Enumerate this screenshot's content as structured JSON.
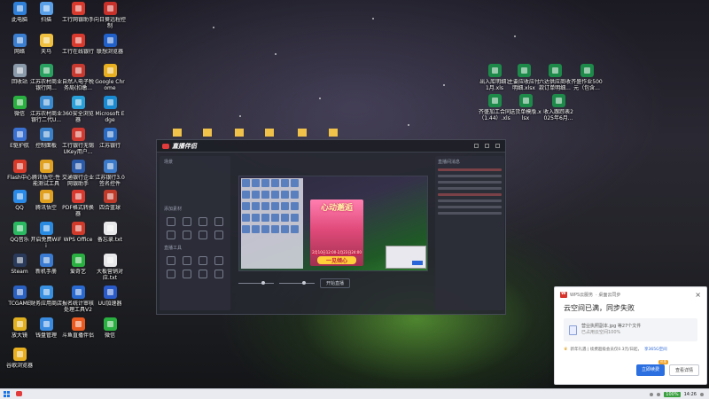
{
  "desktop": {
    "left_icons": [
      {
        "label": "此电脑",
        "color": "#2f7fd8"
      },
      {
        "label": "扫描",
        "color": "#5aa0e8"
      },
      {
        "label": "工行网银助手",
        "color": "#d93a2e"
      },
      {
        "label": "向日葵远程控制",
        "color": "#c8302a"
      },
      {
        "label": "网络",
        "color": "#3b7ed0"
      },
      {
        "label": "天马",
        "color": "#f0c040"
      },
      {
        "label": "工行在线银行",
        "color": "#d93a2e"
      },
      {
        "label": "联想浏览器",
        "color": "#2060c8"
      },
      {
        "label": "回收站",
        "color": "#8a9aaa"
      },
      {
        "label": "江苏农村商业银行网...",
        "color": "#2aa060"
      },
      {
        "label": "自然人电子税务局(扣缴...",
        "color": "#c83a30"
      },
      {
        "label": "Google Chrome",
        "color": "#e8b020"
      },
      {
        "label": "微信",
        "color": "#2ab040"
      },
      {
        "label": "江苏农村商业银行二代U...",
        "color": "#3a8ad0"
      },
      {
        "label": "360安全浏览器",
        "color": "#2aa0d8"
      },
      {
        "label": "Microsoft Edge",
        "color": "#1a8ad0"
      },
      {
        "label": "E驱护航",
        "color": "#3a70d0"
      },
      {
        "label": "控制面板",
        "color": "#3a80c8"
      },
      {
        "label": "工行银行无锡UKey用户...",
        "color": "#d03a30"
      },
      {
        "label": "江苏银行",
        "color": "#2a6ac0"
      },
      {
        "label": "Flash中心",
        "color": "#d83a2a"
      },
      {
        "label": "腾讯悟空:性能测试工具",
        "color": "#e0a020"
      },
      {
        "label": "交通银行企业网银助手",
        "color": "#2a5aa8"
      },
      {
        "label": "江苏银行3.0签名控件",
        "color": "#3a7ac8"
      },
      {
        "label": "QQ",
        "color": "#2a8ae8"
      },
      {
        "label": "腾讯悟空",
        "color": "#e0a020"
      },
      {
        "label": "PDF格式转换器",
        "color": "#d83a30"
      },
      {
        "label": "四合蓝球",
        "color": "#c03a2a"
      },
      {
        "label": "QQ音乐",
        "color": "#2ab860"
      },
      {
        "label": "开启免费WiFi",
        "color": "#2a8ae0"
      },
      {
        "label": "WPS Office",
        "color": "#d03a2a"
      },
      {
        "label": "备忘录.txt",
        "color": "#e8e8ea"
      },
      {
        "label": "Steam",
        "color": "#2a3a5a"
      },
      {
        "label": "新机手册",
        "color": "#3a7ad0"
      },
      {
        "label": "爱奇艺",
        "color": "#2ab040"
      },
      {
        "label": "大板营销对应.txt",
        "color": "#e8e8ea"
      },
      {
        "label": "TCGAME",
        "color": "#2a60c0"
      },
      {
        "label": "财务应用商店",
        "color": "#3a90e0"
      },
      {
        "label": "报名统计审核处理工具V2",
        "color": "#2a6ad0"
      },
      {
        "label": "UU加速器",
        "color": "#2a5ac8"
      },
      {
        "label": "放大镜",
        "color": "#e0b020"
      },
      {
        "label": "钱盘管理",
        "color": "#3a8ae0"
      },
      {
        "label": "斗鱼直播伴侣",
        "color": "#e85a20"
      },
      {
        "label": "微信",
        "color": "#2ab040"
      },
      {
        "label": "谷歌浏览器",
        "color": "#e8b020"
      }
    ],
    "right_icons": [
      {
        "label": "出入库明细11月.xls",
        "color": "#1d8a4a"
      },
      {
        "label": "主要应收应付明细.xlsx",
        "color": "#1d8a4a"
      },
      {
        "label": "六达供应商收款订单明细...",
        "color": "#1d8a4a"
      },
      {
        "label": "齐盛作业500元（包含...",
        "color": "#1d8a4a"
      },
      {
        "label": "齐盛加工合同（1.44）.xlsx",
        "color": "#1d8a4a"
      },
      {
        "label": "送货单模版.xlsx",
        "color": "#1d8a4a"
      },
      {
        "label": "收入跟踪表2025年6月...",
        "color": "#1d8a4a"
      }
    ]
  },
  "app": {
    "title": "直播伴侣",
    "left_section": "场景",
    "left_section2": "添加素材",
    "left_section3": "直播工具",
    "promo_title": "心动邂逅",
    "promo_date": "2月10日12:00-2月23日24:00",
    "promo_button": "一见倾心",
    "btn_start": "开始直播",
    "right_title": "直播间消息"
  },
  "notification": {
    "app_name": "WPS云服务",
    "app_sub": "· 桌面云同步",
    "close": "×",
    "title": "云空间已满，同步失败",
    "file_name": "营业执照副本.jpg 等27个文件",
    "file_sub": "已占用云空间100%",
    "vip_text": "新年礼遇 | 续费超级会员仅0.3元/日起，",
    "vip_link": "享365G空间",
    "btn_primary": "立即续费",
    "btn_badge": "优惠",
    "btn_secondary": "查看详情"
  },
  "taskbar": {
    "battery": "100%",
    "time": "14:26"
  }
}
